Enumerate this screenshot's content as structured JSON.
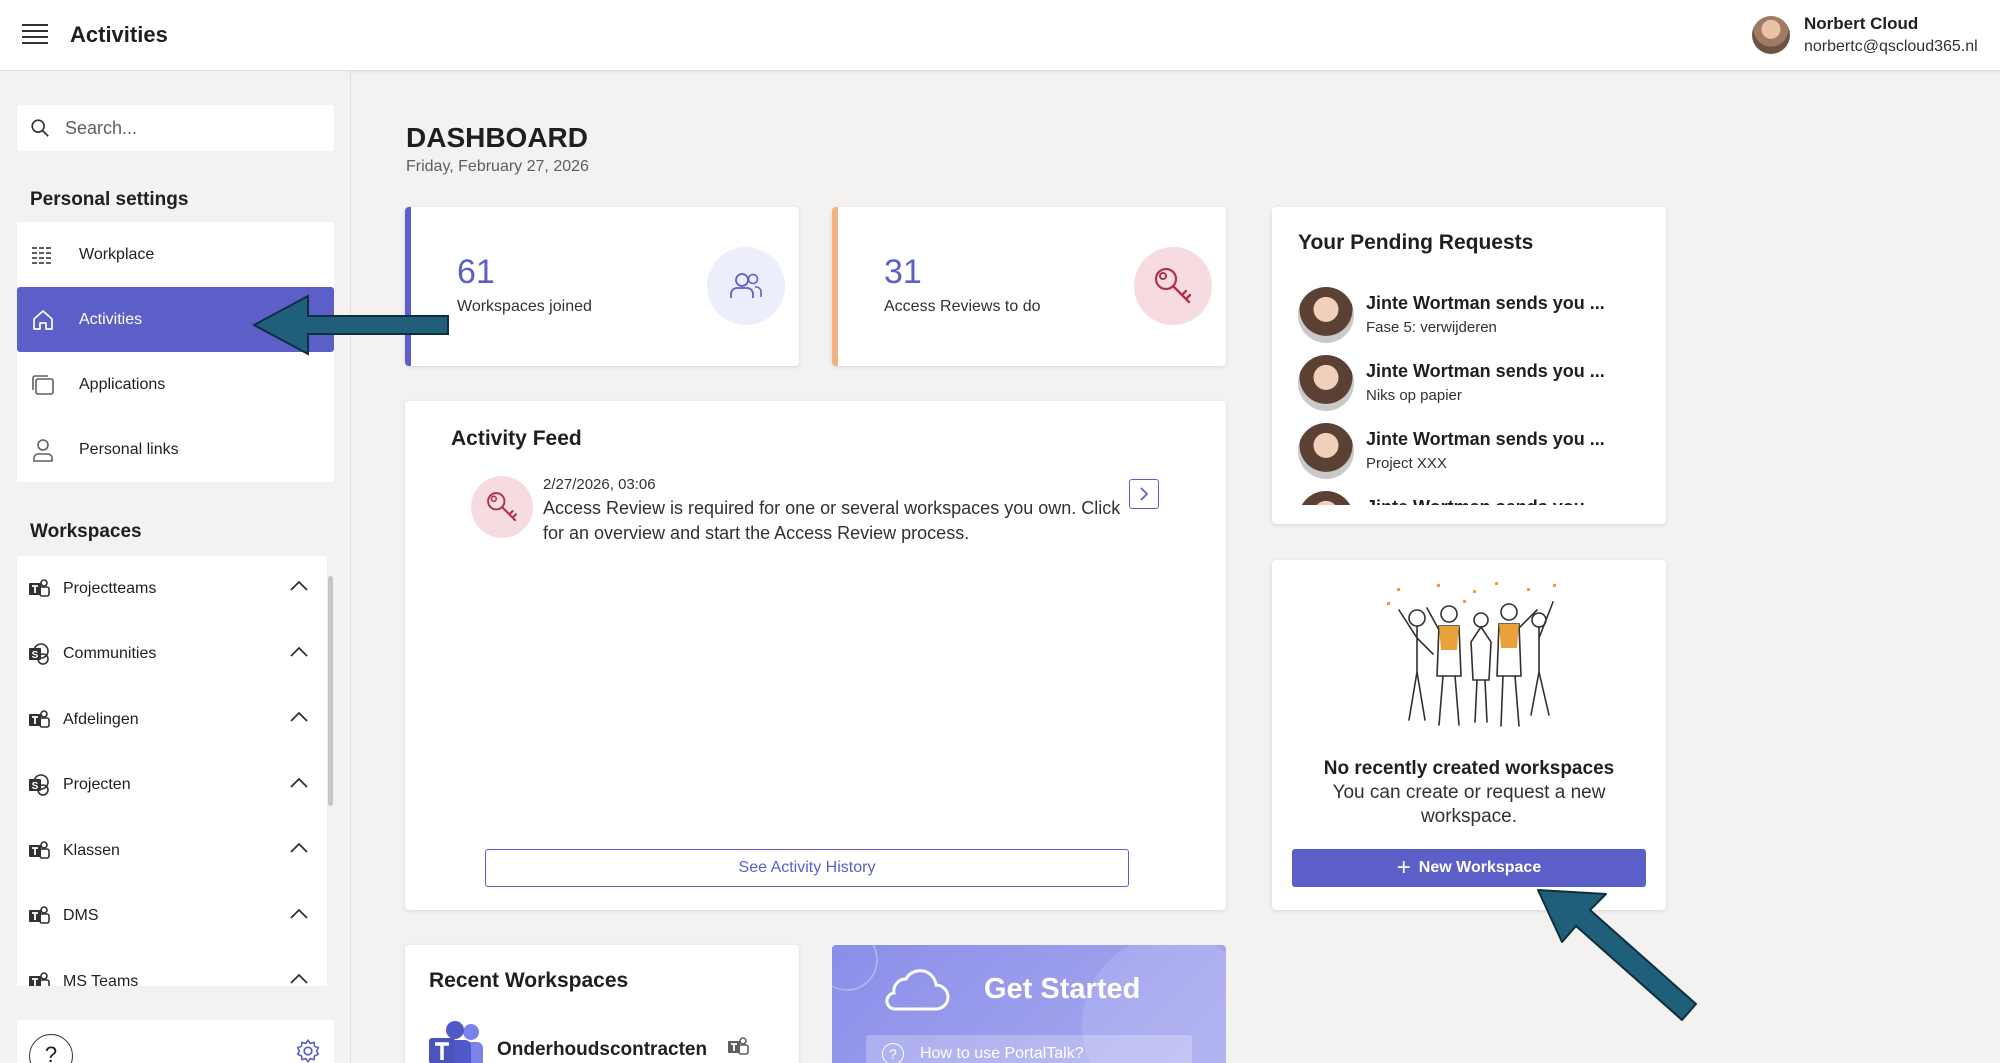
{
  "header": {
    "title": "Activities",
    "user_name": "Norbert Cloud",
    "user_email": "norbertc@qscloud365.nl"
  },
  "sidebar": {
    "search_placeholder": "Search...",
    "personal_settings_title": "Personal settings",
    "personal_items": [
      {
        "label": "Workplace",
        "icon": "grid-icon"
      },
      {
        "label": "Activities",
        "icon": "home-icon",
        "active": true
      },
      {
        "label": "Applications",
        "icon": "applications-icon"
      },
      {
        "label": "Personal links",
        "icon": "person-icon"
      }
    ],
    "workspaces_title": "Workspaces",
    "workspace_items": [
      {
        "label": "Projectteams",
        "icon": "teams-icon"
      },
      {
        "label": "Communities",
        "icon": "sharepoint-icon"
      },
      {
        "label": "Afdelingen",
        "icon": "teams-icon"
      },
      {
        "label": "Projecten",
        "icon": "sharepoint-icon"
      },
      {
        "label": "Klassen",
        "icon": "teams-icon"
      },
      {
        "label": "DMS",
        "icon": "teams-icon"
      },
      {
        "label": "MS Teams",
        "icon": "teams-icon"
      }
    ],
    "help_label": "?"
  },
  "dashboard": {
    "title": "DASHBOARD",
    "date": "Friday, February 27, 2026"
  },
  "stats": {
    "workspaces": {
      "value": "61",
      "label": "Workspaces joined",
      "accent": "#5b5fc7"
    },
    "reviews": {
      "value": "31",
      "label": "Access Reviews to do",
      "accent": "#f4b183"
    }
  },
  "activity_feed": {
    "title": "Activity Feed",
    "items": [
      {
        "date": "2/27/2026, 03:06",
        "text": "Access Review is required for one or several workspaces you own. Click for an overview and start the Access Review process."
      }
    ],
    "history_button": "See Activity History"
  },
  "pending_requests": {
    "title": "Your Pending Requests",
    "items": [
      {
        "name": "Jinte Wortman sends you ...",
        "sub": "Fase 5: verwijderen"
      },
      {
        "name": "Jinte Wortman sends you ...",
        "sub": "Niks op papier"
      },
      {
        "name": "Jinte Wortman sends you ...",
        "sub": "Project XXX"
      }
    ]
  },
  "new_workspaces": {
    "empty_title": "No recently created workspaces",
    "empty_text": "You can create or request a new workspace.",
    "button_label": "New Workspace"
  },
  "recent_workspaces": {
    "title": "Recent Workspaces",
    "items": [
      {
        "name": "Onderhoudscontracten"
      }
    ]
  },
  "get_started": {
    "title": "Get Started",
    "link": "How to use PortalTalk?"
  },
  "colors": {
    "accent": "#5b5fc7",
    "review_red": "#b0324b",
    "annotation_arrow": "#1f5f7a"
  }
}
